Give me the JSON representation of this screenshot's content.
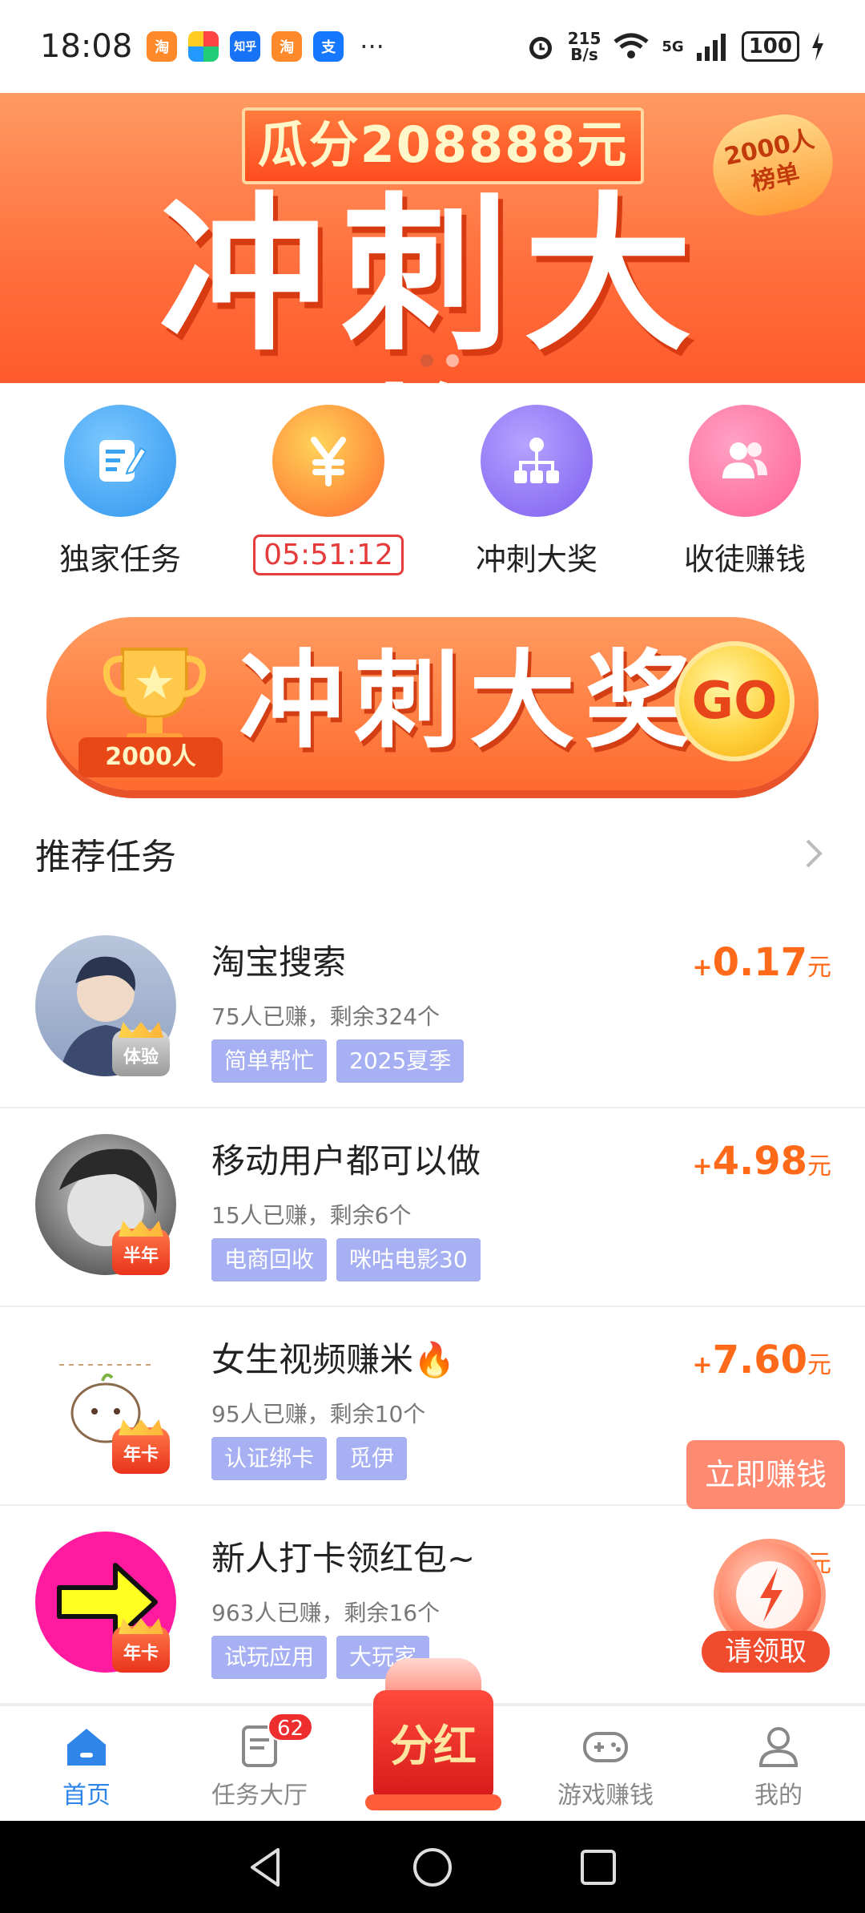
{
  "status_bar": {
    "time": "18:08",
    "apps": [
      {
        "icon": "taobao-icon",
        "color": "#ff8a2b",
        "glyph": "淘"
      },
      {
        "icon": "pinwheel-icon",
        "color": "#ffffff",
        "glyph": ""
      },
      {
        "icon": "zhihu-icon",
        "color": "#1772f6",
        "glyph": "知乎"
      },
      {
        "icon": "taobao-icon",
        "color": "#ff8a2b",
        "glyph": "淘"
      },
      {
        "icon": "alipay-icon",
        "color": "#1677ff",
        "glyph": "支"
      }
    ],
    "more": "···",
    "speed_value": "215",
    "speed_unit": "B/s",
    "network": "5G",
    "battery": "100"
  },
  "banner": {
    "top_text": "瓜分208888元",
    "main_text": "冲刺大奖",
    "badge_line1": "2000人",
    "badge_line2": "榜单"
  },
  "quick_menu": [
    {
      "icon": "edit-task-icon",
      "label": "独家任务",
      "color": "#3aa3f2"
    },
    {
      "icon": "yuan-icon",
      "label": "05:51:12",
      "color": "#ffb43a",
      "is_timer": true
    },
    {
      "icon": "hierarchy-icon",
      "label": "冲刺大奖",
      "color": "#8b6ff0"
    },
    {
      "icon": "users-icon",
      "label": "收徒赚钱",
      "color": "#ff6fa0"
    }
  ],
  "sprint_banner": {
    "trophy_label": "2000人",
    "title": "冲刺大奖",
    "go": "GO"
  },
  "recommended": {
    "title": "推荐任务",
    "tasks": [
      {
        "name": "淘宝搜索",
        "stats": "75人已赚，剩余324个",
        "tags": [
          "简单帮忙",
          "2025夏季"
        ],
        "reward_plus": "+",
        "reward": "0.17",
        "unit": "元",
        "badge": "体验",
        "avatar_color": "#c9d3e6"
      },
      {
        "name": "移动用户都可以做",
        "stats": "15人已赚，剩余6个",
        "tags": [
          "电商回收",
          "咪咕电影30"
        ],
        "reward_plus": "+",
        "reward": "4.98",
        "unit": "元",
        "badge": "半年",
        "avatar_color": "#9a9a9a"
      },
      {
        "name": "女生视频赚米🔥",
        "stats": "95人已赚，剩余10个",
        "tags": [
          "认证绑卡",
          "觅伊"
        ],
        "reward_plus": "+",
        "reward": "7.60",
        "unit": "元",
        "badge": "年卡",
        "avatar_color": "#f3efe9"
      },
      {
        "name": "新人打卡领红包~",
        "stats": "963人已赚，剩余16个",
        "tags": [
          "试玩应用",
          "大玩家"
        ],
        "reward_plus": "+",
        "reward": "",
        "unit": "元",
        "badge": "年卡",
        "avatar_color": "#ff1aa0"
      }
    ]
  },
  "floating": {
    "earn_now": "立即赚钱",
    "claim": "请领取"
  },
  "bottom_nav": {
    "items": [
      {
        "icon": "home-icon",
        "label": "首页",
        "active": true
      },
      {
        "icon": "task-hall-icon",
        "label": "任务大厅",
        "badge": "62"
      },
      {
        "icon": "red-packet-icon",
        "label": "分红"
      },
      {
        "icon": "gamepad-icon",
        "label": "游戏赚钱"
      },
      {
        "icon": "profile-icon",
        "label": "我的"
      }
    ]
  },
  "colors": {
    "accent_blue": "#2f86e8",
    "reward_orange": "#ff6a1a",
    "tag_purple": "#a6b0f2",
    "banner_orange": "#ff6f3d"
  }
}
